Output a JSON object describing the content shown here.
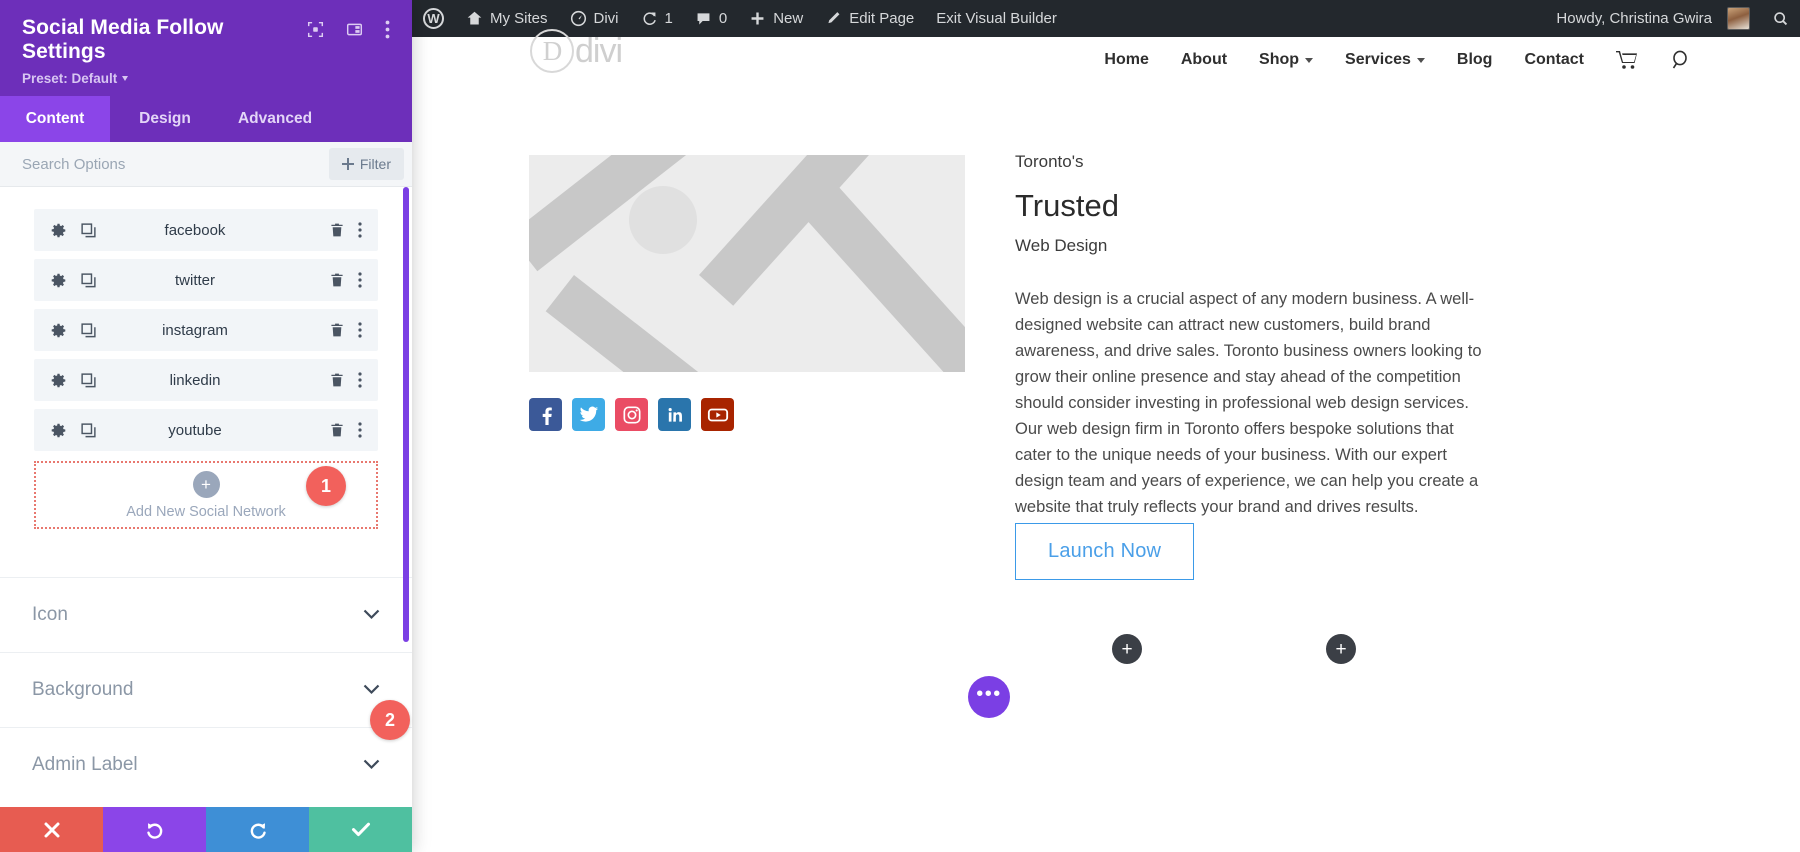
{
  "admin_bar": {
    "items": [
      {
        "icon": "wordpress-logo-icon",
        "label": ""
      },
      {
        "icon": "my-sites-icon",
        "label": "My Sites"
      },
      {
        "icon": "divi-dashboard-icon",
        "label": "Divi"
      },
      {
        "icon": "updates-icon",
        "label": "1"
      },
      {
        "icon": "comments-icon",
        "label": "0"
      },
      {
        "icon": "plus-icon",
        "label": "New"
      },
      {
        "icon": "pencil-icon",
        "label": "Edit Page"
      },
      {
        "icon": "",
        "label": "Exit Visual Builder"
      }
    ],
    "howdy": "Howdy, Christina Gwira",
    "search_icon": "search-icon"
  },
  "site_header": {
    "logo_text": "divi",
    "logo_mark": "D",
    "nav": [
      {
        "label": "Home",
        "has_dropdown": false
      },
      {
        "label": "About",
        "has_dropdown": false
      },
      {
        "label": "Shop",
        "has_dropdown": true
      },
      {
        "label": "Services",
        "has_dropdown": true
      },
      {
        "label": "Blog",
        "has_dropdown": false
      },
      {
        "label": "Contact",
        "has_dropdown": false
      }
    ],
    "cart_icon": "shopping-cart-icon",
    "search_icon": "search-icon"
  },
  "hero": {
    "image_alt": "placeholder-image",
    "eyebrow": "Toronto's",
    "title": "Trusted",
    "subtitle": "Web Design",
    "body": "Web design is a crucial aspect of any modern business. A well-designed website can attract new customers, build brand awareness, and drive sales. Toronto business owners looking to grow their online presence and stay ahead of the competition should consider investing in professional web design services. Our web design firm in Toronto offers bespoke solutions that cater to the unique needs of your business. With our expert design team and years of experience, we can help you create a website that truly reflects your brand and drives results.",
    "cta_label": "Launch Now",
    "social_icons": [
      {
        "name": "facebook-icon",
        "color": "#3b5998",
        "glyph": "f"
      },
      {
        "name": "twitter-icon",
        "color": "#3eabe6",
        "glyph": "t"
      },
      {
        "name": "instagram-icon",
        "color": "#ea4c64",
        "glyph": "ig"
      },
      {
        "name": "linkedin-icon",
        "color": "#2a75ac",
        "glyph": "in"
      },
      {
        "name": "youtube-icon",
        "color": "#a82400",
        "glyph": "yt"
      }
    ]
  },
  "builder_controls": {
    "add_row_label": "+",
    "add_column_label": "+",
    "more_label": "•••"
  },
  "panel": {
    "title": "Social Media Follow Settings",
    "preset_label": "Preset: Default",
    "header_icons": [
      {
        "name": "responsive-preview-icon"
      },
      {
        "name": "layout-columns-icon"
      },
      {
        "name": "more-vertical-icon"
      }
    ],
    "tabs": [
      {
        "label": "Content",
        "active": true
      },
      {
        "label": "Design",
        "active": false
      },
      {
        "label": "Advanced",
        "active": false
      }
    ],
    "search": {
      "placeholder": "Search Options",
      "value": ""
    },
    "filter_label": "Filter",
    "networks": [
      {
        "name": "facebook"
      },
      {
        "name": "twitter"
      },
      {
        "name": "instagram"
      },
      {
        "name": "linkedin"
      },
      {
        "name": "youtube"
      }
    ],
    "row_icons": {
      "settings": "gear-icon",
      "duplicate": "duplicate-icon",
      "delete": "trash-icon",
      "more": "more-vertical-icon"
    },
    "add_new": {
      "label": "Add New Social Network",
      "plus": "+"
    },
    "sections": [
      {
        "label": "Icon",
        "expanded": false
      },
      {
        "label": "Background",
        "expanded": false
      },
      {
        "label": "Admin Label",
        "expanded": false
      }
    ],
    "footer_buttons": [
      {
        "name": "cancel-button",
        "icon": "close-icon",
        "color": "#e75c51"
      },
      {
        "name": "undo-button",
        "icon": "undo-icon",
        "color": "#8b45e8"
      },
      {
        "name": "redo-button",
        "icon": "redo-icon",
        "color": "#3e8fd6"
      },
      {
        "name": "save-button",
        "icon": "check-icon",
        "color": "#4fc0a0"
      }
    ]
  },
  "annotations": {
    "badge_1": "1",
    "badge_2": "2",
    "badge_color": "#f2615c"
  }
}
